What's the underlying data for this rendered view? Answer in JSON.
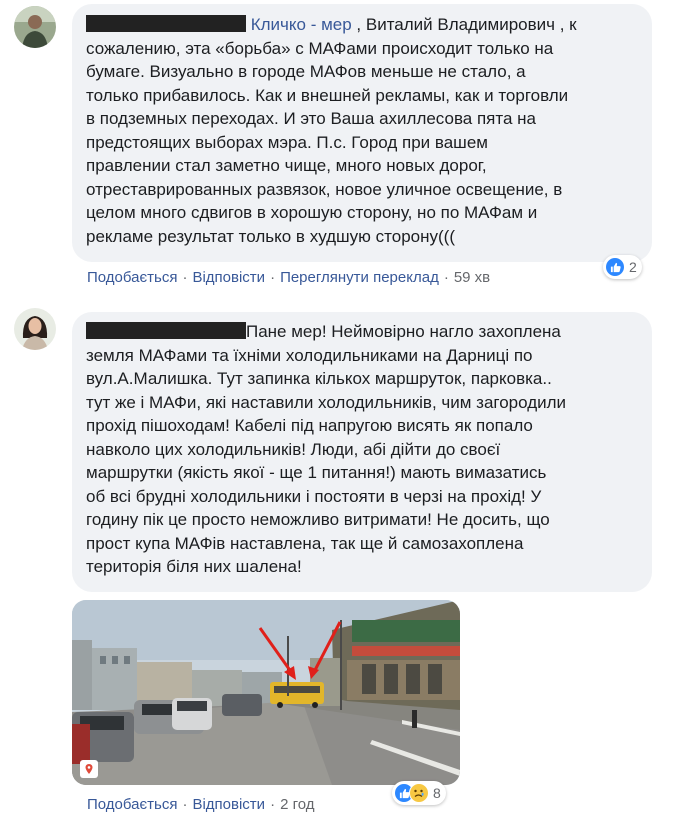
{
  "comment1": {
    "author_redacted": "████████ ████████",
    "mention": "Кличко - мер",
    "text_after_mention": " , Виталий Владимирович , к\nсожалению, эта «борьба» с МАФами происходит только на\nбумаге. Визуально в городе МАФов меньше не стало, а\nтолько прибавилось. Как и внешней рекламы, как и торговли\nв подземных переходах. И это Ваша ахиллесова пята на\nпредстоящих выборах мэра. П.с. Город при вашем\nправлении стал заметно чище, много новых дорог,\nотреставрированных развязок, новое уличное освещение, в\nцелом много сдвигов в хорошую сторону, но по МАФам и\nрекламе результат только в худшую сторону(((",
    "like_label": "Подобається",
    "reply_label": "Відповісти",
    "translate_label": "Переглянути переклад",
    "time": "59 хв",
    "reaction_count": "2"
  },
  "comment2": {
    "author_redacted": "████ ██████████",
    "text": "Пане мер! Неймовірно нагло захоплена\nземля МАФами та їхніми холодильниками на Дарниці по\nвул.А.Малишка. Тут запинка кількох маршруток, парковка..\nтут же і МАФи, які наставили холодильників, чим загородили\nпрохід пішоходам! Кабелі під напругою висять як попало\nнавколо цих холодильників! Люди, абі дійти до своєї\nмаршрутки (якість якої - ще 1 питання!) мають вимазатись\nоб всі брудні холодильники і постояти в черзі на прохід! У\nгодину пік це просто неможливо витримати! Не досить, що\nпрост купа МАФів наставлена, так ще й самозахоплена\nтериторія біля них шалена!",
    "like_label": "Подобається",
    "reply_label": "Відповісти",
    "time": "2 год",
    "reaction_count": "8"
  },
  "colors": {
    "bubble": "#f0f2f5",
    "link": "#385898",
    "meta": "#65676b",
    "like_blue": "#2d88ff",
    "arrow_red": "#e0201a"
  },
  "icons": [
    "avatar-man",
    "avatar-woman",
    "like-icon",
    "sad-icon",
    "street-photo",
    "map-pin-icon"
  ]
}
